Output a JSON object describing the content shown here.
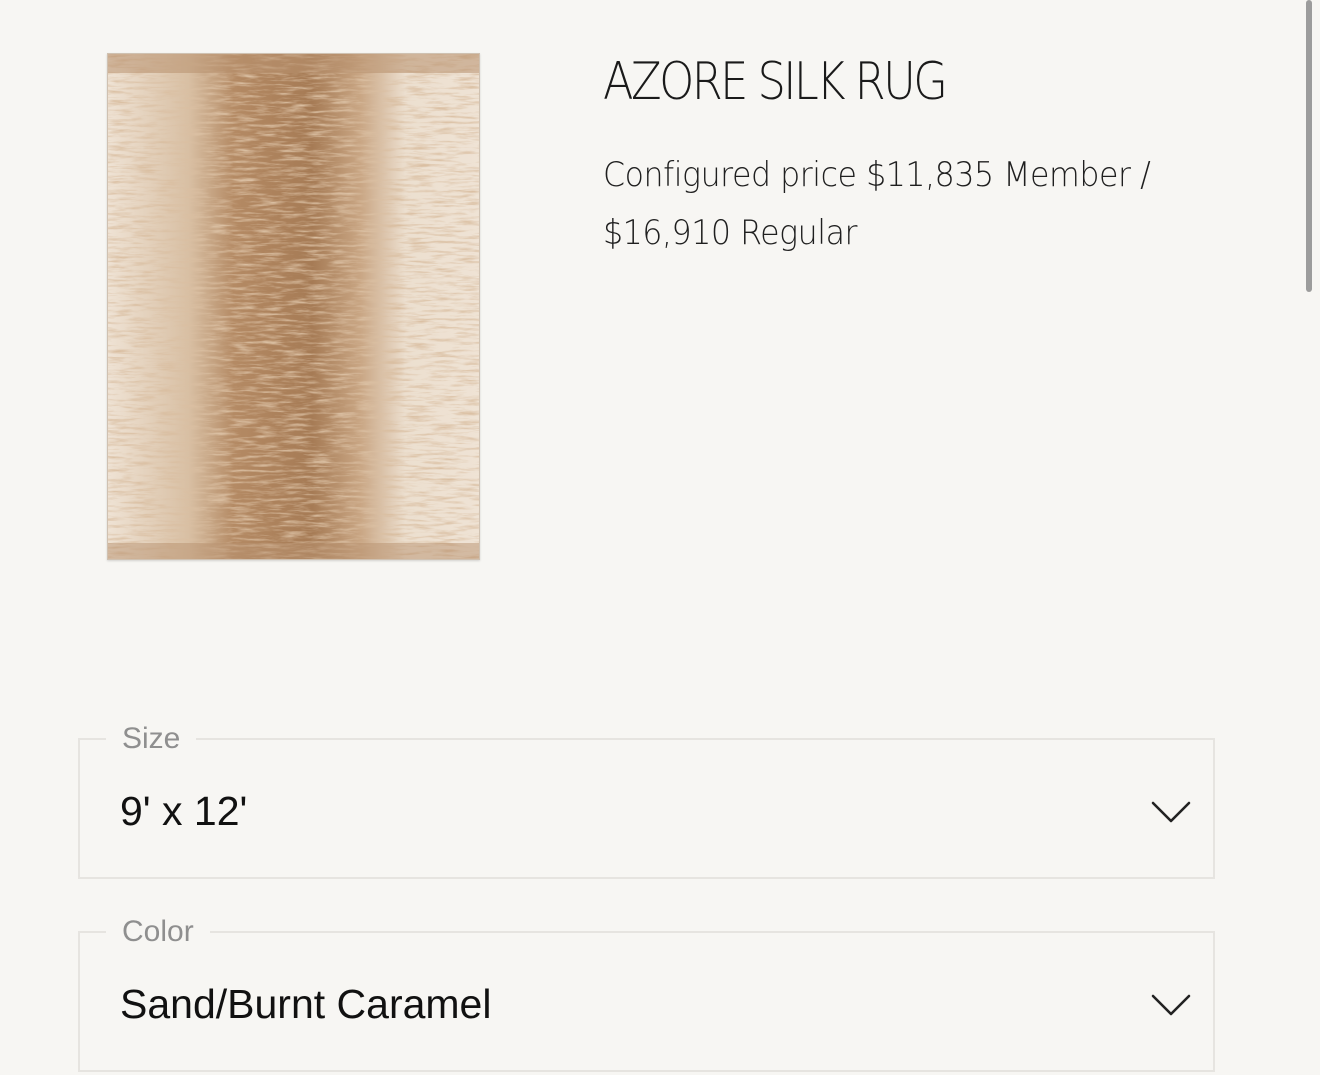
{
  "product": {
    "title": "AZORE SILK RUG",
    "price_line_1": "Configured price  $11,835 Member /",
    "price_line_2": "$16,910 Regular",
    "image_alt": "Azore Silk Rug"
  },
  "options": {
    "size": {
      "label": "Size",
      "value": "9' x 12'"
    },
    "color": {
      "label": "Color",
      "value": "Sand/Burnt Caramel"
    }
  },
  "icons": {
    "dropdown": "chevron-down-icon"
  },
  "colors": {
    "background": "#f7f6f3",
    "border": "#e6e4e0",
    "label": "#8f8f8f",
    "rug_light": "#efe2d3",
    "rug_dark": "#b08560"
  }
}
